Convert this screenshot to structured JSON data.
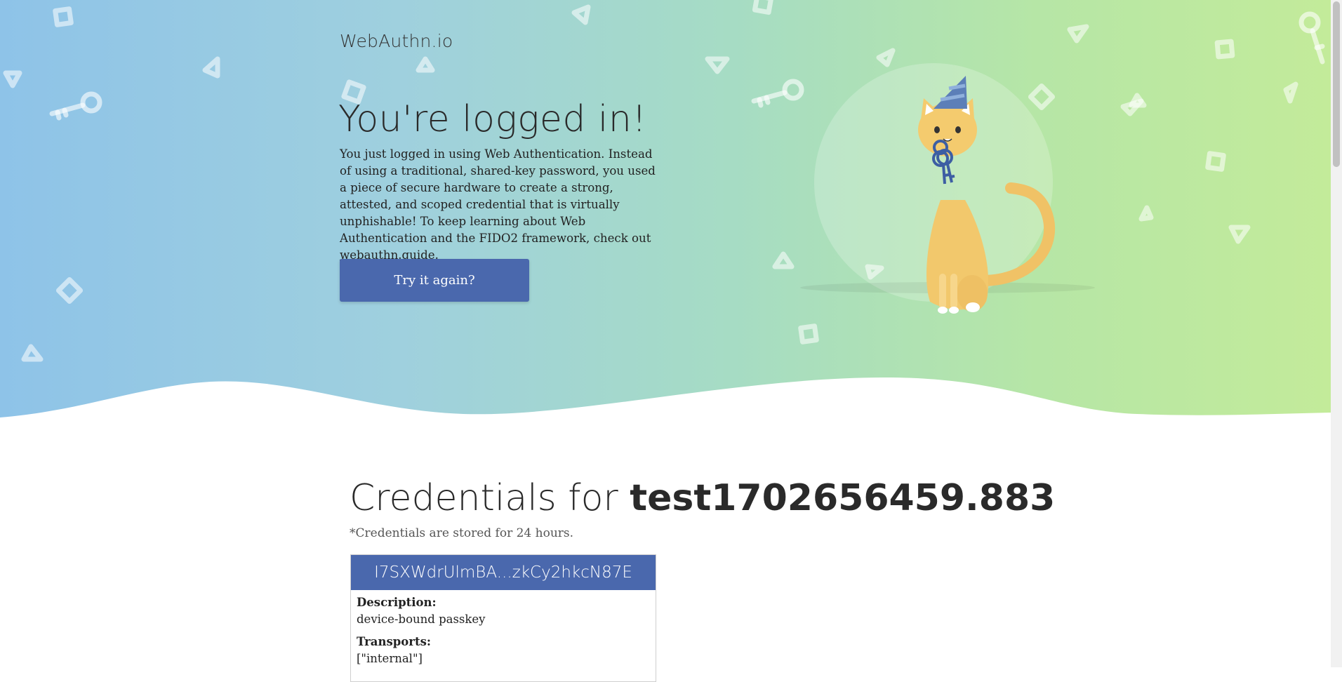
{
  "brand": "WebAuthn.io",
  "hero": {
    "title": "You're logged in!",
    "body_before_link": "You just logged in using Web Authentication. Instead of using a traditional, shared-key password, you used a piece of secure hardware to create a strong, attested, and scoped credential that is virtually unphishable! To keep learning about Web Authentication and the FIDO2 framework, check out ",
    "link_text": "webauthn.guide",
    "body_after_link": ".",
    "button_label": "Try it again?"
  },
  "credentials": {
    "title_prefix": "Credentials for ",
    "username": "test1702656459.883",
    "note": "*Credentials are stored for 24 hours.",
    "items": [
      {
        "id": "I7SXWdrUlmBA...zkCy2hkcN87E",
        "description_label": "Description:",
        "description": "device-bound passkey",
        "transports_label": "Transports:",
        "transports": "[\"internal\"]"
      }
    ]
  },
  "colors": {
    "accent": "#4a68ad",
    "hero_left": "#8ec3e8",
    "hero_right": "#c3eb9a"
  },
  "icons": [
    "cat-mascot-icon",
    "key-icon",
    "triangle-shape",
    "diamond-shape"
  ]
}
